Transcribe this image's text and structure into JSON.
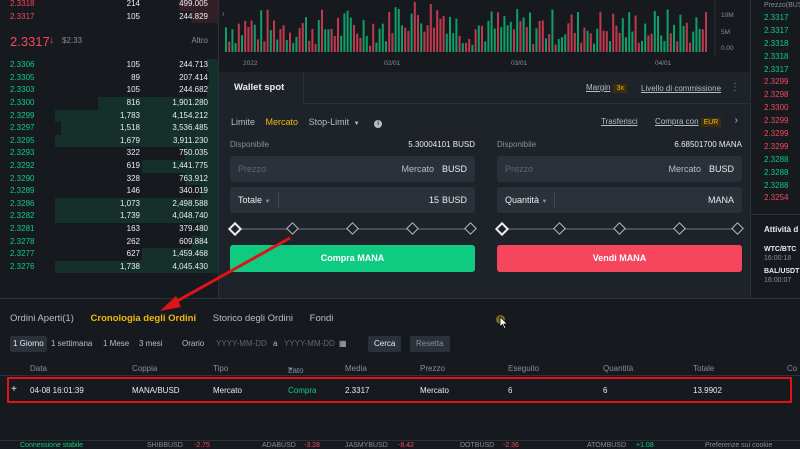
{
  "orderbook": {
    "asks_top": [
      {
        "price": "2.3318",
        "amount": "214",
        "total": "499.005"
      },
      {
        "price": "2.3317",
        "amount": "105",
        "total": "244.829"
      }
    ],
    "mid": {
      "price": "2.3317",
      "arrow": "↓",
      "usd": "$2.33",
      "more": "Altro"
    },
    "bids": [
      {
        "price": "2.3306",
        "amount": "105",
        "total": "244.713",
        "depth": 0.05
      },
      {
        "price": "2.3305",
        "amount": "89",
        "total": "207.414",
        "depth": 0.04
      },
      {
        "price": "2.3303",
        "amount": "105",
        "total": "244.682",
        "depth": 0.05
      },
      {
        "price": "2.3300",
        "amount": "816",
        "total": "1,901.280",
        "depth": 0.55
      },
      {
        "price": "2.3299",
        "amount": "1,783",
        "total": "4,154.212",
        "depth": 0.75
      },
      {
        "price": "2.3297",
        "amount": "1,518",
        "total": "3,536.485",
        "depth": 0.72
      },
      {
        "price": "2.3295",
        "amount": "1,679",
        "total": "3,911.230",
        "depth": 0.75
      },
      {
        "price": "2.3293",
        "amount": "322",
        "total": "750.035",
        "depth": 0.15
      },
      {
        "price": "2.3292",
        "amount": "619",
        "total": "1,441.775",
        "depth": 0.35
      },
      {
        "price": "2.3290",
        "amount": "328",
        "total": "763.912",
        "depth": 0.15
      },
      {
        "price": "2.3289",
        "amount": "146",
        "total": "340.019",
        "depth": 0.08
      },
      {
        "price": "2.3286",
        "amount": "1,073",
        "total": "2,498.588",
        "depth": 0.75
      },
      {
        "price": "2.3282",
        "amount": "1,739",
        "total": "4,048.740",
        "depth": 0.75
      },
      {
        "price": "2.3281",
        "amount": "163",
        "total": "379.480",
        "depth": 0.08
      },
      {
        "price": "2.3278",
        "amount": "262",
        "total": "609.884",
        "depth": 0.12
      },
      {
        "price": "2.3277",
        "amount": "627",
        "total": "1,459.468",
        "depth": 0.35
      },
      {
        "price": "2.3276",
        "amount": "1,738",
        "total": "4,045.430",
        "depth": 0.75
      }
    ]
  },
  "chart": {
    "x_labels": [
      "2022",
      "02/01",
      "03/01",
      "04/01"
    ],
    "y_labels": [
      "10M",
      "5M",
      "0.00"
    ]
  },
  "trades": {
    "header": "Prezzo(BUSD)",
    "rows": [
      {
        "price": "2.3317",
        "side": "buy"
      },
      {
        "price": "2.3317",
        "side": "buy"
      },
      {
        "price": "2.3318",
        "side": "buy"
      },
      {
        "price": "2.3318",
        "side": "buy"
      },
      {
        "price": "2.3317",
        "side": "buy"
      },
      {
        "price": "2.3299",
        "side": "sell"
      },
      {
        "price": "2.3298",
        "side": "sell"
      },
      {
        "price": "2.3300",
        "side": "sell"
      },
      {
        "price": "2.3299",
        "side": "sell"
      },
      {
        "price": "2.3299",
        "side": "sell"
      },
      {
        "price": "2.3299",
        "side": "sell"
      },
      {
        "price": "2.3288",
        "side": "buy"
      },
      {
        "price": "2.3288",
        "side": "buy"
      },
      {
        "price": "2.3288",
        "side": "buy"
      },
      {
        "price": "2.3254",
        "side": "sell"
      }
    ]
  },
  "activity": {
    "title": "Attività d",
    "items": [
      {
        "pair": "WTC/BTC",
        "time": "16:00:18"
      },
      {
        "pair": "BAL/USDT",
        "time": "16:00:07"
      }
    ]
  },
  "wallet": {
    "tab": "Wallet spot",
    "margin": "Margin",
    "margin_badge": "3x",
    "fee_link": "Livello di commissione",
    "order_types": [
      "Limite",
      "Mercato",
      "Stop-Limit"
    ],
    "active_order_type": "Mercato",
    "transfer": "Trasferisci",
    "buy_with": "Compra con",
    "buy_with_currency": "EUR",
    "buy": {
      "available_label": "Disponibile",
      "available_value": "5.30004101 BUSD",
      "price_placeholder": "Prezzo",
      "price_market": "Mercato",
      "price_unit": "BUSD",
      "total_label": "Totale",
      "total_value": "15",
      "total_unit": "BUSD",
      "button": "Compra MANA"
    },
    "sell": {
      "available_label": "Disponibile",
      "available_value": "6.68501700 MANA",
      "price_placeholder": "Prezzo",
      "price_market": "Mercato",
      "price_unit": "BUSD",
      "qty_label": "Quantità",
      "qty_unit": "MANA",
      "button": "Vendi MANA"
    }
  },
  "bottom": {
    "tabs": [
      "Ordini Aperti(1)",
      "Cronologia degli Ordini",
      "Storico degli Ordini",
      "Fondi"
    ],
    "active_tab": "Cronologia degli Ordini",
    "periods": [
      "1 Giorno",
      "1 settimana",
      "1 Mese",
      "3 mesi"
    ],
    "active_period": "1 Giorno",
    "time_label": "Orario",
    "date_from": "YYYY-MM-DD",
    "date_sep": "a",
    "date_to": "YYYY-MM-DD",
    "search_btn": "Cerca",
    "reset_btn": "Resetta",
    "columns": [
      "Data",
      "Coppia",
      "Tipo",
      "Lato",
      "Media",
      "Prezzo",
      "Eseguito",
      "Quantità",
      "Totale",
      "Co"
    ],
    "row": {
      "expand": "+",
      "date": "04-08 16:01:39",
      "pair": "MANA/BUSD",
      "type": "Mercato",
      "side": "Compra",
      "avg": "2.3317",
      "price": "Mercato",
      "executed": "6",
      "qty": "6",
      "total": "13.9902"
    },
    "status": {
      "connection": "Connessione stabile",
      "tickers": [
        "SHIBBUSD",
        "ADABUSD",
        "JASMYBUSD",
        "DOTBUSD",
        "ATOMBUSD"
      ],
      "ticker_changes": [
        "-2.75",
        "-3.28",
        "-8.42",
        "-2.36",
        "+1.08"
      ],
      "cookie": "Preferenze sui cookie"
    }
  },
  "colors": {
    "accent": "#f0b90b",
    "buy": "#0ecb81",
    "sell": "#f6465d",
    "highlight": "#e0121a"
  }
}
